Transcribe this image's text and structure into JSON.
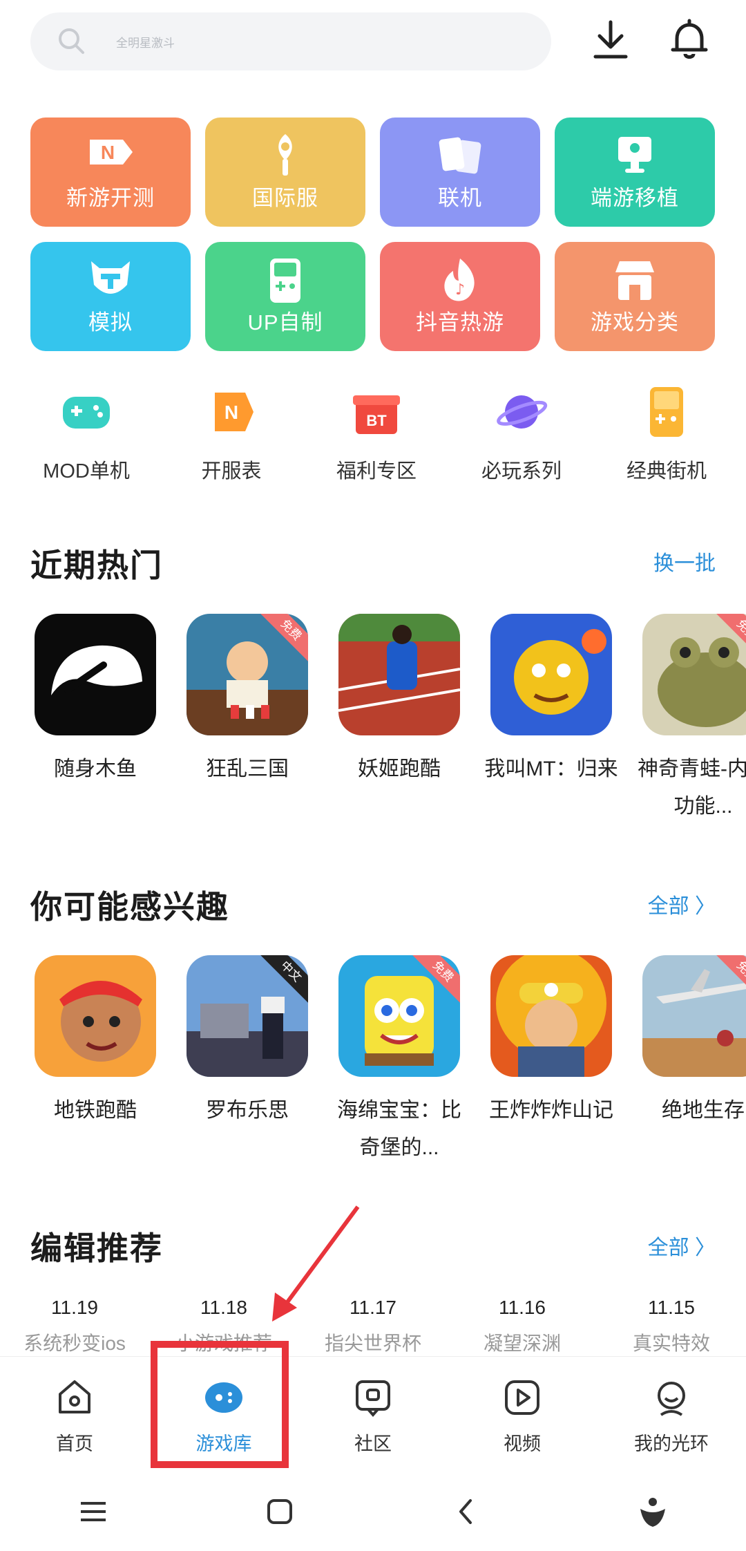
{
  "search": {
    "placeholder": "全明星激斗"
  },
  "header_icons": [
    "download-icon",
    "bell-icon"
  ],
  "tiles": [
    {
      "label": "新游开测",
      "color": "#f7875a",
      "icon": "new-game-icon"
    },
    {
      "label": "国际服",
      "color": "#efc45f",
      "icon": "globe-sword-icon"
    },
    {
      "label": "联机",
      "color": "#8c96f4",
      "icon": "cards-icon"
    },
    {
      "label": "端游移植",
      "color": "#2dcba9",
      "icon": "monitor-icon"
    },
    {
      "label": "模拟",
      "color": "#35c5ed",
      "icon": "emulator-mask-icon"
    },
    {
      "label": "UP自制",
      "color": "#4bd38b",
      "icon": "handheld-self-made-icon"
    },
    {
      "label": "抖音热游",
      "color": "#f4746e",
      "icon": "douyin-flame-icon"
    },
    {
      "label": "游戏分类",
      "color": "#f4956c",
      "icon": "shop-icon"
    }
  ],
  "shortcuts": [
    {
      "label": "MOD单机",
      "icon": "gamepad-icon"
    },
    {
      "label": "开服表",
      "icon": "server-open-icon"
    },
    {
      "label": "福利专区",
      "icon": "gift-bt-icon"
    },
    {
      "label": "必玩系列",
      "icon": "planet-icon"
    },
    {
      "label": "经典街机",
      "icon": "arcade-icon"
    }
  ],
  "hot": {
    "title": "近期热门",
    "more": "换一批",
    "games": [
      {
        "name": "随身木鱼",
        "badge": ""
      },
      {
        "name": "狂乱三国",
        "badge": "免费"
      },
      {
        "name": "妖姬跑酷",
        "badge": ""
      },
      {
        "name": "我叫MT：归来",
        "badge": ""
      },
      {
        "name": "神奇青蛙-内置功能...",
        "badge": "免费"
      }
    ]
  },
  "interest": {
    "title": "你可能感兴趣",
    "more": "全部 〉",
    "games": [
      {
        "name": "地铁跑酷",
        "badge": ""
      },
      {
        "name": "罗布乐思",
        "badge": "中文"
      },
      {
        "name": "海绵宝宝：比奇堡的...",
        "badge": "免费"
      },
      {
        "name": "王炸炸炸山记",
        "badge": ""
      },
      {
        "name": "绝地生存",
        "badge": "免费"
      }
    ]
  },
  "editor": {
    "title": "编辑推荐",
    "more": "全部 〉",
    "items": [
      {
        "date": "11.19",
        "text": "系统秒变ios"
      },
      {
        "date": "11.18",
        "text": "小游戏推荐"
      },
      {
        "date": "11.17",
        "text": "指尖世界杯"
      },
      {
        "date": "11.16",
        "text": "凝望深渊"
      },
      {
        "date": "11.15",
        "text": "真实特效"
      }
    ]
  },
  "bottom_nav": [
    {
      "label": "首页",
      "icon": "home-icon",
      "active": false
    },
    {
      "label": "游戏库",
      "icon": "game-library-icon",
      "active": true
    },
    {
      "label": "社区",
      "icon": "community-icon",
      "active": false
    },
    {
      "label": "视频",
      "icon": "video-icon",
      "active": false
    },
    {
      "label": "我的光环",
      "icon": "profile-icon",
      "active": false
    }
  ],
  "accent": "#2b8fd9",
  "annotation_color": "#e8343b"
}
